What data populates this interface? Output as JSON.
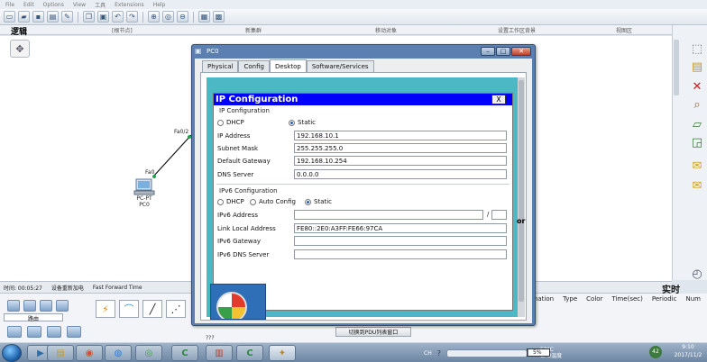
{
  "app": {
    "menu": [
      "File",
      "Edit",
      "Options",
      "View",
      "工具",
      "Extensions",
      "Help"
    ],
    "mode_tab_logic": "逻辑",
    "mode_bar": {
      "root": "[根节点]",
      "new_cluster": "新集群",
      "move_object": "移动对象",
      "set_background": "设置工作区背景",
      "viewport": "视图区"
    }
  },
  "topology": {
    "switch_port": "Fa0/2",
    "pc_port": "Fa0",
    "pc_type": "PC-PT",
    "pc_name": "PC0"
  },
  "time_bar": {
    "time_label": "时间: 00:05:27",
    "reset_label": "设备重新加电",
    "fast_forward": "Fast Forward Time",
    "realtime": "实时"
  },
  "device_panel": {
    "caption": "路由",
    "number": "???",
    "pdu_button": "切换到PDU列表窗口",
    "pdu_headers": [
      "ination",
      "Type",
      "Color",
      "Time(sec)",
      "Periodic",
      "Num"
    ]
  },
  "pc_window": {
    "title": "PC0",
    "tabs": [
      "Physical",
      "Config",
      "Desktop",
      "Software/Services"
    ],
    "active_tab": "Desktop",
    "side_cut_text": "or"
  },
  "ip_config": {
    "header": "IP Configuration",
    "close": "X",
    "section_ipv4": "IP Configuration",
    "mode_dhcp": "DHCP",
    "mode_static": "Static",
    "ipv4_selected": "Static",
    "ip_address_label": "IP Address",
    "ip_address": "192.168.10.1",
    "subnet_mask_label": "Subnet Mask",
    "subnet_mask": "255.255.255.0",
    "gateway_label": "Default Gateway",
    "gateway": "192.168.10.254",
    "dns_label": "DNS Server",
    "dns": "0.0.0.0",
    "section_ipv6": "IPv6 Configuration",
    "v6_dhcp": "DHCP",
    "v6_auto": "Auto Config",
    "v6_static": "Static",
    "ipv6_selected": "Static",
    "ipv6_address_label": "IPv6 Address",
    "ipv6_address": "",
    "ipv6_prefix_sep": "/",
    "link_local_label": "Link Local Address",
    "link_local": "FE80::2E0:A3FF:FE66:97CA",
    "ipv6_gateway_label": "IPv6 Gateway",
    "ipv6_gateway": "",
    "ipv6_dns_label": "IPv6 DNS Server",
    "ipv6_dns": ""
  },
  "taskbar": {
    "tray_ch": "CH",
    "temp": "53°C",
    "cpu": "CPU温度",
    "battery": "5%",
    "battery_level": 0.05,
    "badge": "42",
    "time": "9:10",
    "date": "2017/11/2"
  },
  "colors": {
    "ipcfg_header": "#0000ff",
    "desktop_bg": "#4cb8c5",
    "window_frame": "#5a7fb0"
  }
}
